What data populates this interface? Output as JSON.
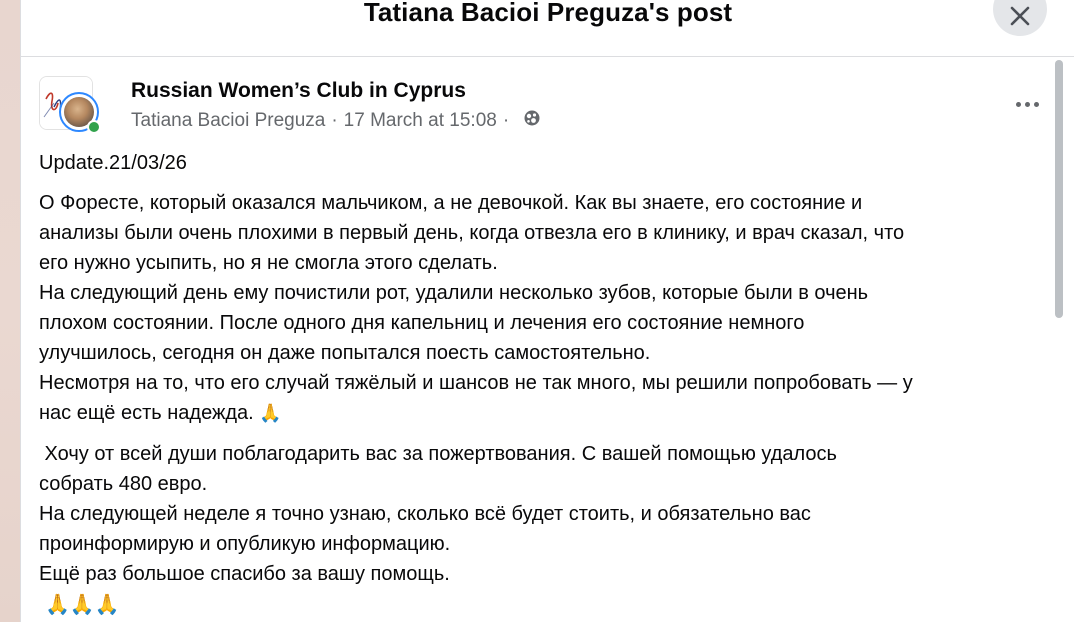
{
  "dialog": {
    "title": "Tatiana Bacioi Preguza's post",
    "close_icon": "close-icon"
  },
  "post": {
    "group_name": "Russian Women’s Club in Cyprus",
    "author": "Tatiana Bacioi Preguza",
    "separator": "·",
    "timestamp": "17 March at 15:08",
    "audience_icon": "globe-icon",
    "more_icon": "more-options-icon",
    "update_line": "Update.21/03/26",
    "para1_lines": [
      "О Форесте, который оказался мальчиком, а не девочкой. Как вы знаете, его состояние и",
      "анализы были очень плохими в первый день, когда отвезла его в клинику, и врач сказал, что",
      "его нужно усыпить, но я не смогла этого сделать.",
      "На следующий день ему почистили рот, удалили несколько зубов, которые были в очень",
      "плохом состоянии. После одного дня капельниц и лечения его состояние немного",
      "улучшилось, сегодня он даже попытался поесть самостоятельно.",
      "Несмотря на то, что его случай тяжёлый и шансов не так много, мы решили попробовать — у"
    ],
    "para1_last": "нас ещё есть надежда. ",
    "para2_lines": [
      " Хочу от всей души поблагодарить вас за пожертвования. С вашей помощью удалось",
      "собрать 480 евро.",
      "На следующей неделе я точно узнаю, сколько всё будет стоить, и обязательно вас",
      "проинформирую и опубликую информацию.",
      "Ещё раз большое спасибо за вашу помощь."
    ],
    "pray_emoji": "🙏",
    "pray_emoji_row": "🙏🙏🙏"
  }
}
